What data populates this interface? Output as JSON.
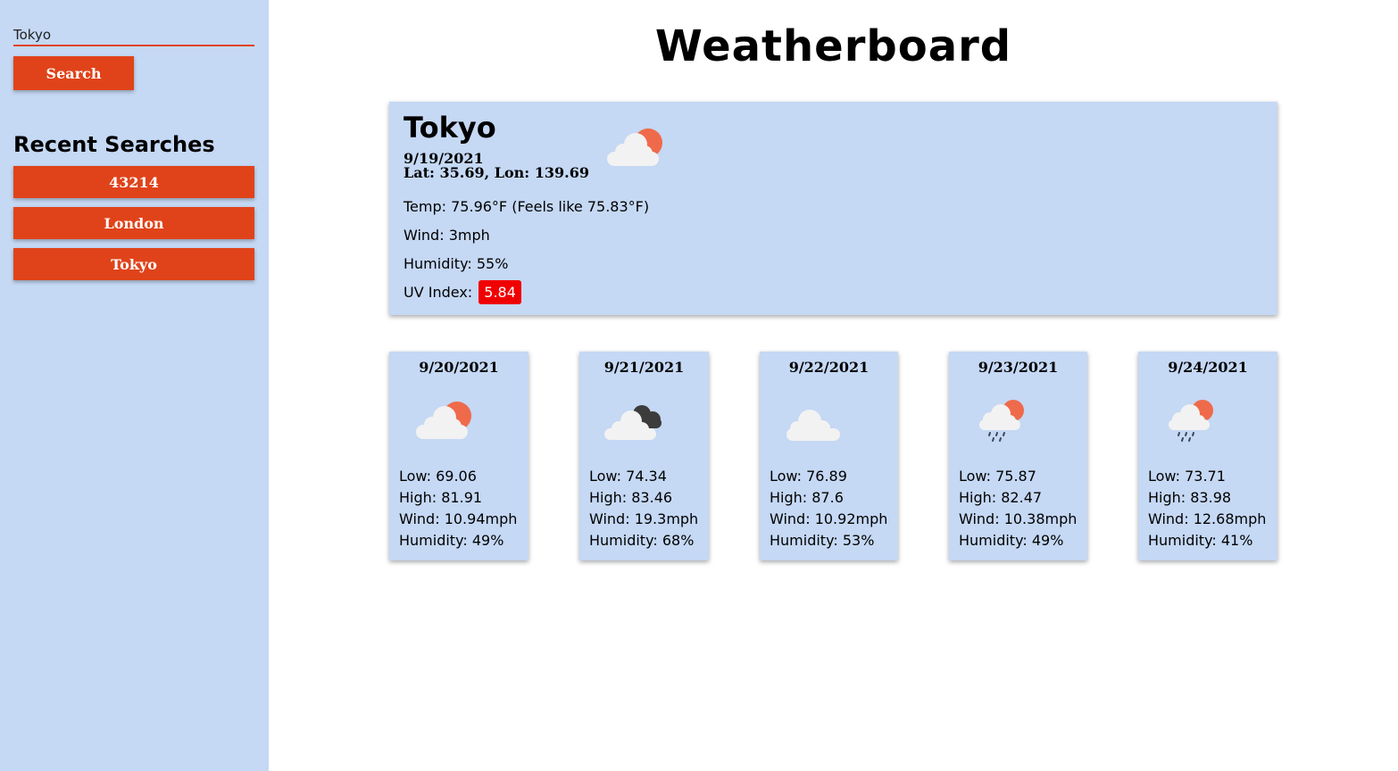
{
  "search": {
    "value": "Tokyo",
    "button_label": "Search"
  },
  "recent": {
    "title": "Recent Searches",
    "items": [
      "43214",
      "London",
      "Tokyo"
    ]
  },
  "page": {
    "title": "Weatherboard"
  },
  "current": {
    "city": "Tokyo",
    "date": "9/19/2021",
    "coords": "Lat: 35.69, Lon: 139.69",
    "icon": "partly-cloudy-icon",
    "temp": "Temp: 75.96°F (Feels like 75.83°F)",
    "wind": "Wind: 3mph",
    "humidity": "Humidity: 55%",
    "uv_label": "UV Index:",
    "uv_value": "5.84",
    "uv_color": "#f00000"
  },
  "forecast": [
    {
      "date": "9/20/2021",
      "icon": "partly-cloudy-icon",
      "low": "Low: 69.06",
      "high": "High: 81.91",
      "wind": "Wind: 10.94mph",
      "humidity": "Humidity: 49%"
    },
    {
      "date": "9/21/2021",
      "icon": "broken-clouds-icon",
      "low": "Low: 74.34",
      "high": "High: 83.46",
      "wind": "Wind: 19.3mph",
      "humidity": "Humidity: 68%"
    },
    {
      "date": "9/22/2021",
      "icon": "cloud-icon",
      "low": "Low: 76.89",
      "high": "High: 87.6",
      "wind": "Wind: 10.92mph",
      "humidity": "Humidity: 53%"
    },
    {
      "date": "9/23/2021",
      "icon": "rain-icon",
      "low": "Low: 75.87",
      "high": "High: 82.47",
      "wind": "Wind: 10.38mph",
      "humidity": "Humidity: 49%"
    },
    {
      "date": "9/24/2021",
      "icon": "rain-icon",
      "low": "Low: 73.71",
      "high": "High: 83.98",
      "wind": "Wind: 12.68mph",
      "humidity": "Humidity: 41%"
    }
  ],
  "colors": {
    "accent": "#e0431a",
    "panel": "#c5d8f4",
    "sun": "#ef6a4a"
  }
}
